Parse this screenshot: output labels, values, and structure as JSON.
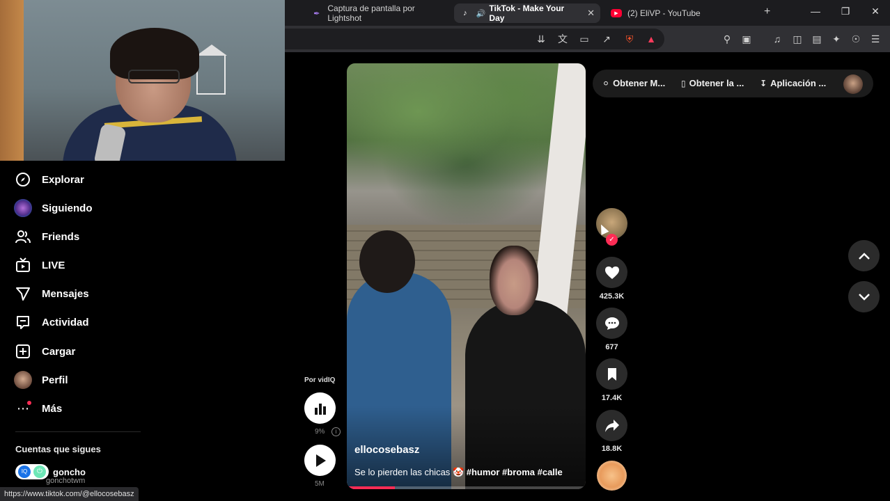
{
  "browser": {
    "tabs": [
      {
        "label": "Captura de pantalla por Lightshot",
        "icon": "feather-icon",
        "active": false
      },
      {
        "label": "TikTok - Make Your Day",
        "icon": "tiktok-icon",
        "active": true
      },
      {
        "label": "(2) EliVP - YouTube",
        "icon": "youtube-icon",
        "active": false
      }
    ],
    "status_url": "https://www.tiktok.com/@ellocosebasz"
  },
  "sidebar": {
    "items": [
      {
        "label": "Explorar",
        "icon": "compass-icon"
      },
      {
        "label": "Siguiendo",
        "icon": "avatar"
      },
      {
        "label": "Friends",
        "icon": "friends-icon"
      },
      {
        "label": "LIVE",
        "icon": "live-tv-icon"
      },
      {
        "label": "Mensajes",
        "icon": "send-icon"
      },
      {
        "label": "Actividad",
        "icon": "activity-icon"
      },
      {
        "label": "Cargar",
        "icon": "upload-plus-icon"
      },
      {
        "label": "Perfil",
        "icon": "avatar"
      },
      {
        "label": "Más",
        "icon": "more-dots-icon"
      }
    ],
    "following_title": "Cuentas que sigues",
    "following": [
      {
        "name": "goncho",
        "handle": "gonchotwm"
      }
    ]
  },
  "topbar": {
    "get_coins": "Obtener M...",
    "get_app": "Obtener la ...",
    "app_download": "Aplicación ..."
  },
  "video": {
    "username": "ellocosebasz",
    "caption": "Se lo pierden las chicas",
    "hashtags": "#humor #broma #calle",
    "progress": 0.2
  },
  "vidiq": {
    "label": "Por vidIQ",
    "percent": "9%",
    "views": "5M"
  },
  "actions": {
    "likes": "425.3K",
    "comments": "677",
    "saves": "17.4K",
    "shares": "18.8K"
  },
  "colors": {
    "accent": "#fe2c55",
    "background": "#000000",
    "tab_active": "#303034"
  }
}
